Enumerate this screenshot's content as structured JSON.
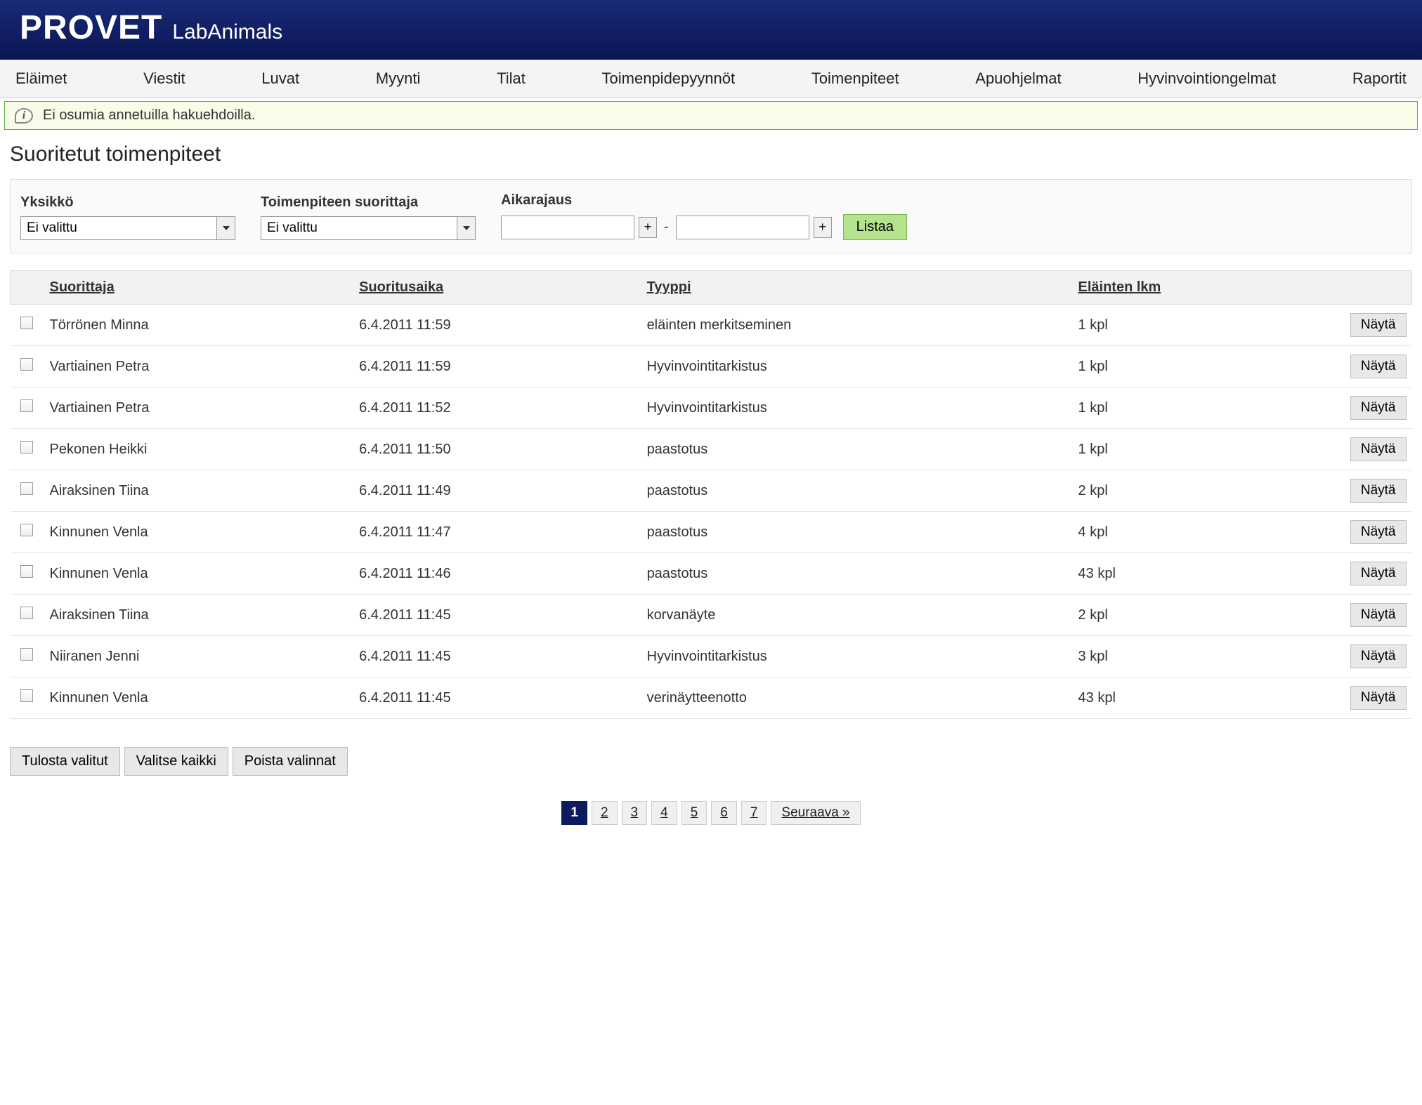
{
  "header": {
    "brand": "PROVET",
    "subbrand": "LabAnimals"
  },
  "nav": [
    "Eläimet",
    "Viestit",
    "Luvat",
    "Myynti",
    "Tilat",
    "Toimenpidepyynnöt",
    "Toimenpiteet",
    "Apuohjelmat",
    "Hyvinvointiongelmat",
    "Raportit"
  ],
  "info_message": "Ei osumia annetuilla hakuehdoilla.",
  "page_title": "Suoritetut toimenpiteet",
  "filters": {
    "unit_label": "Yksikkö",
    "unit_value": "Ei valittu",
    "performer_label": "Toimenpiteen suorittaja",
    "performer_value": "Ei valittu",
    "daterange_label": "Aikarajaus",
    "date_from": "",
    "date_to": "",
    "range_separator": "-",
    "plus_label": "+",
    "list_button": "Listaa"
  },
  "table": {
    "headers": {
      "performer": "Suorittaja",
      "time": "Suoritusaika",
      "type": "Tyyppi",
      "count": "Eläinten lkm"
    },
    "action_label": "Näytä",
    "rows": [
      {
        "performer": "Törrönen Minna",
        "time": "6.4.2011 11:59",
        "type": "eläinten merkitseminen",
        "count": "1 kpl"
      },
      {
        "performer": "Vartiainen Petra",
        "time": "6.4.2011 11:59",
        "type": "Hyvinvointitarkistus",
        "count": "1 kpl"
      },
      {
        "performer": "Vartiainen Petra",
        "time": "6.4.2011 11:52",
        "type": "Hyvinvointitarkistus",
        "count": "1 kpl"
      },
      {
        "performer": "Pekonen Heikki",
        "time": "6.4.2011 11:50",
        "type": "paastotus",
        "count": "1 kpl"
      },
      {
        "performer": "Airaksinen Tiina",
        "time": "6.4.2011 11:49",
        "type": "paastotus",
        "count": "2 kpl"
      },
      {
        "performer": "Kinnunen Venla",
        "time": "6.4.2011 11:47",
        "type": "paastotus",
        "count": "4 kpl"
      },
      {
        "performer": "Kinnunen Venla",
        "time": "6.4.2011 11:46",
        "type": "paastotus",
        "count": "43 kpl"
      },
      {
        "performer": "Airaksinen Tiina",
        "time": "6.4.2011 11:45",
        "type": "korvanäyte",
        "count": "2 kpl"
      },
      {
        "performer": "Niiranen Jenni",
        "time": "6.4.2011 11:45",
        "type": "Hyvinvointitarkistus",
        "count": "3 kpl"
      },
      {
        "performer": "Kinnunen Venla",
        "time": "6.4.2011 11:45",
        "type": "verinäytteenotto",
        "count": "43 kpl"
      }
    ]
  },
  "bottom_actions": {
    "print_selected": "Tulosta valitut",
    "select_all": "Valitse kaikki",
    "clear_selection": "Poista valinnat"
  },
  "pagination": {
    "pages": [
      "1",
      "2",
      "3",
      "4",
      "5",
      "6",
      "7"
    ],
    "active": "1",
    "next": "Seuraava »"
  }
}
